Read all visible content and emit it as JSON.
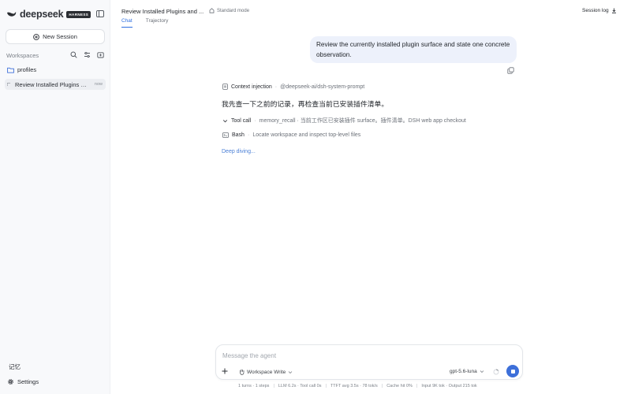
{
  "sidebar": {
    "brand": "deepseek",
    "badge": "HARNESS",
    "new_session": "New Session",
    "workspaces_title": "Workspaces",
    "folder": "profiles",
    "session": {
      "label": "Review Installed Plugins and...",
      "time": "now"
    },
    "memory": "记忆",
    "settings": "Settings"
  },
  "header": {
    "title": "Review Installed Plugins and ...",
    "mode": "Standard mode",
    "tabs": [
      {
        "label": "Chat"
      },
      {
        "label": "Trajectory"
      }
    ],
    "session_log": "Session log"
  },
  "chat": {
    "user_message": "Review the currently installed plugin surface and state one concrete observation.",
    "steps": [
      {
        "kind": "Context injection",
        "detail": "@deepseek-ai/dsh-system-prompt"
      },
      {
        "kind": "Tool call",
        "detail": "memory_recall · 当前工作区已安装插件 surface。插件清单。DSH web app checkout"
      },
      {
        "kind": "Bash",
        "detail": "Locate workspace and inspect top-level files"
      }
    ],
    "assistant_reply": "我先查一下之前的记录，再检查当前已安装插件清单。",
    "thinking": "Deep diving..."
  },
  "composer": {
    "placeholder": "Message the agent",
    "access": "Workspace Write",
    "model": "gpt-5.6-luna"
  },
  "stats": {
    "turns": "1 turns · 1 steps",
    "llm": "LLM 6.2s · Tool call 0s",
    "ttft": "TTFT avg 3.5s · 78 tok/s",
    "cache": "Cache hit 0%",
    "tokens": "Input 9K tok · Output 215 tok"
  },
  "colors": {
    "accent": "#2f6fe0",
    "user_bubble": "#edf1fb",
    "stop_button": "#3d6fd9",
    "sidebar_bg": "#f8f9fb"
  },
  "icons": [
    "whale-logo-icon",
    "sidebar-toggle-icon",
    "plus-circle-icon",
    "search-icon",
    "sliders-icon",
    "new-folder-icon",
    "folder-icon",
    "spinner-icon",
    "gear-icon",
    "cloud-icon",
    "download-icon",
    "copy-icon",
    "document-icon",
    "chevron-down-icon",
    "terminal-icon",
    "plus-icon",
    "hand-icon",
    "context-ring-icon",
    "stop-icon"
  ]
}
